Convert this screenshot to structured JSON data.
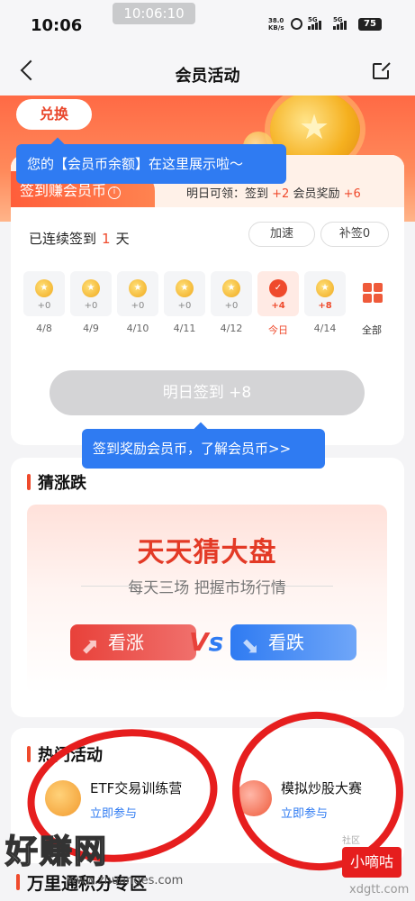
{
  "status": {
    "time": "10:06",
    "capture_time": "10:06:10",
    "speed": "38.0",
    "speed_unit": "KB/s",
    "sig1": "5G",
    "sig2": "5G",
    "battery": "75"
  },
  "nav": {
    "title": "会员活动"
  },
  "header": {
    "exchange_label": "兑换"
  },
  "tips": {
    "balance": "您的【会员币余额】在这里展示啦～",
    "reward": "签到奖励会员币，了解会员币>>"
  },
  "sign": {
    "tag": "签到赚会员币",
    "tomorrow_prefix": "明日可领：签到",
    "tomorrow_sign": "+2",
    "tomorrow_mid": "会员奖励",
    "tomorrow_member": "+6",
    "streak_prefix": "已连续签到",
    "streak_days": "1",
    "streak_suffix": "天",
    "speed_up": "加速",
    "makeup": "补签0",
    "days": [
      {
        "value": "+0",
        "label": "4/8"
      },
      {
        "value": "+0",
        "label": "4/9"
      },
      {
        "value": "+0",
        "label": "4/10"
      },
      {
        "value": "+0",
        "label": "4/11"
      },
      {
        "value": "+0",
        "label": "4/12"
      },
      {
        "value": "+4",
        "label": "今日"
      },
      {
        "value": "+8",
        "label": "4/14"
      }
    ],
    "all_label": "全部",
    "button": "明日签到 +8"
  },
  "guess": {
    "title": "猜涨跌",
    "banner_title": "天天猜大盘",
    "banner_sub": "每天三场 把握市场行情",
    "up": "看涨",
    "down": "看跌"
  },
  "hot": {
    "title": "热门活动",
    "items": [
      {
        "name": "ETF交易训练营",
        "join": "立即参与"
      },
      {
        "name": "模拟炒股大赛",
        "join": "立即参与"
      }
    ]
  },
  "bottom_title": "万里通积分专区",
  "watermark": {
    "brand": "好赚网",
    "url": "www.zhuanges.com",
    "badge": "小嘀咕",
    "corner": "xdgtt.com",
    "community": "社区"
  },
  "colors": {
    "accent": "#ef4a2c",
    "blue": "#2f7bf2",
    "annotation": "#e61e1e"
  }
}
